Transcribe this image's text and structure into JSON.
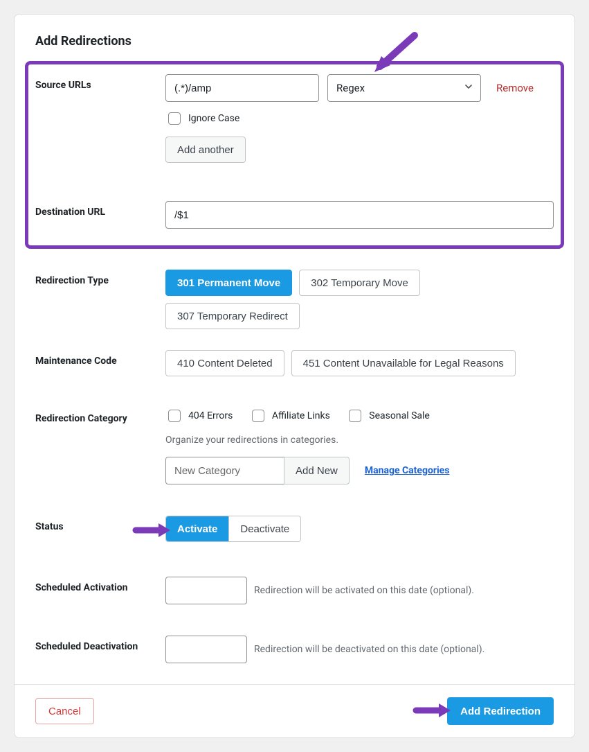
{
  "title": "Add Redirections",
  "source": {
    "label": "Source URLs",
    "value": "(.*)/amp",
    "matchType": "Regex",
    "remove": "Remove",
    "ignoreCase": "Ignore Case",
    "addAnother": "Add another"
  },
  "destination": {
    "label": "Destination URL",
    "value": "/$1"
  },
  "redirectionType": {
    "label": "Redirection Type",
    "options": [
      "301 Permanent Move",
      "302 Temporary Move",
      "307 Temporary Redirect"
    ],
    "active": "301 Permanent Move"
  },
  "maintenanceCode": {
    "label": "Maintenance Code",
    "options": [
      "410 Content Deleted",
      "451 Content Unavailable for Legal Reasons"
    ]
  },
  "category": {
    "label": "Redirection Category",
    "options": [
      "404 Errors",
      "Affiliate Links",
      "Seasonal Sale"
    ],
    "help": "Organize your redirections in categories.",
    "newPlaceholder": "New Category",
    "addNew": "Add New",
    "manage": "Manage Categories"
  },
  "status": {
    "label": "Status",
    "options": [
      "Activate",
      "Deactivate"
    ],
    "active": "Activate"
  },
  "scheduledActivation": {
    "label": "Scheduled Activation",
    "help": "Redirection will be activated on this date (optional)."
  },
  "scheduledDeactivation": {
    "label": "Scheduled Deactivation",
    "help": "Redirection will be deactivated on this date (optional)."
  },
  "footer": {
    "cancel": "Cancel",
    "submit": "Add Redirection"
  },
  "colors": {
    "accent": "#1b9ae4",
    "highlight": "#7b3ab8",
    "danger": "#d63638"
  }
}
